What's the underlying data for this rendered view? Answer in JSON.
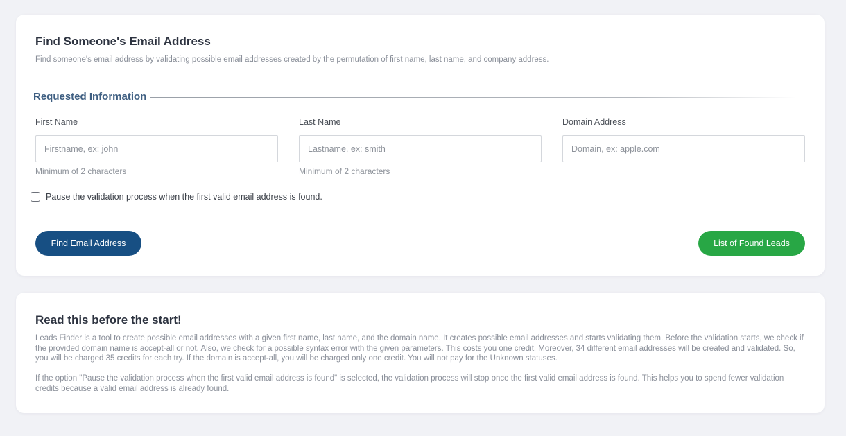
{
  "finder": {
    "title": "Find Someone's Email Address",
    "subtitle": "Find someone's email address by validating possible email addresses created by the permutation of first name, last name, and company address.",
    "section_title": "Requested Information",
    "fields": {
      "first_name": {
        "label": "First Name",
        "placeholder": "Firstname, ex: john",
        "value": "",
        "hint": "Minimum of 2 characters"
      },
      "last_name": {
        "label": "Last Name",
        "placeholder": "Lastname, ex: smith",
        "value": "",
        "hint": "Minimum of 2 characters"
      },
      "domain": {
        "label": "Domain Address",
        "placeholder": "Domain, ex: apple.com",
        "value": ""
      }
    },
    "pause_option": {
      "label": "Pause the validation process when the first valid email address is found.",
      "checked": false
    },
    "find_button_label": "Find Email Address",
    "leads_button_label": "List of Found Leads"
  },
  "info": {
    "title": "Read this before the start!",
    "paragraphs": [
      "Leads Finder is a tool to create possible email addresses with a given first name, last name, and the domain name. It creates possible email addresses and starts validating them. Before the validation starts, we check if the provided domain name is accept-all or not. Also, we check for a possible syntax error with the given parameters. This costs you one credit. Moreover, 34 different email addresses will be created and validated. So, you will be charged 35 credits for each try. If the domain is accept-all, you will be charged only one credit. You will not pay for the Unknown statuses.",
      "If the option \"Pause the validation process when the first valid email address is found\" is selected, the validation process will stop once the first valid email address is found. This helps you to spend fewer validation credits because a valid email address is already found."
    ]
  },
  "colors": {
    "page_background": "#f1f2f6",
    "primary_button": "#174f83",
    "success_button": "#28a745",
    "section_title": "#3f5f82"
  }
}
